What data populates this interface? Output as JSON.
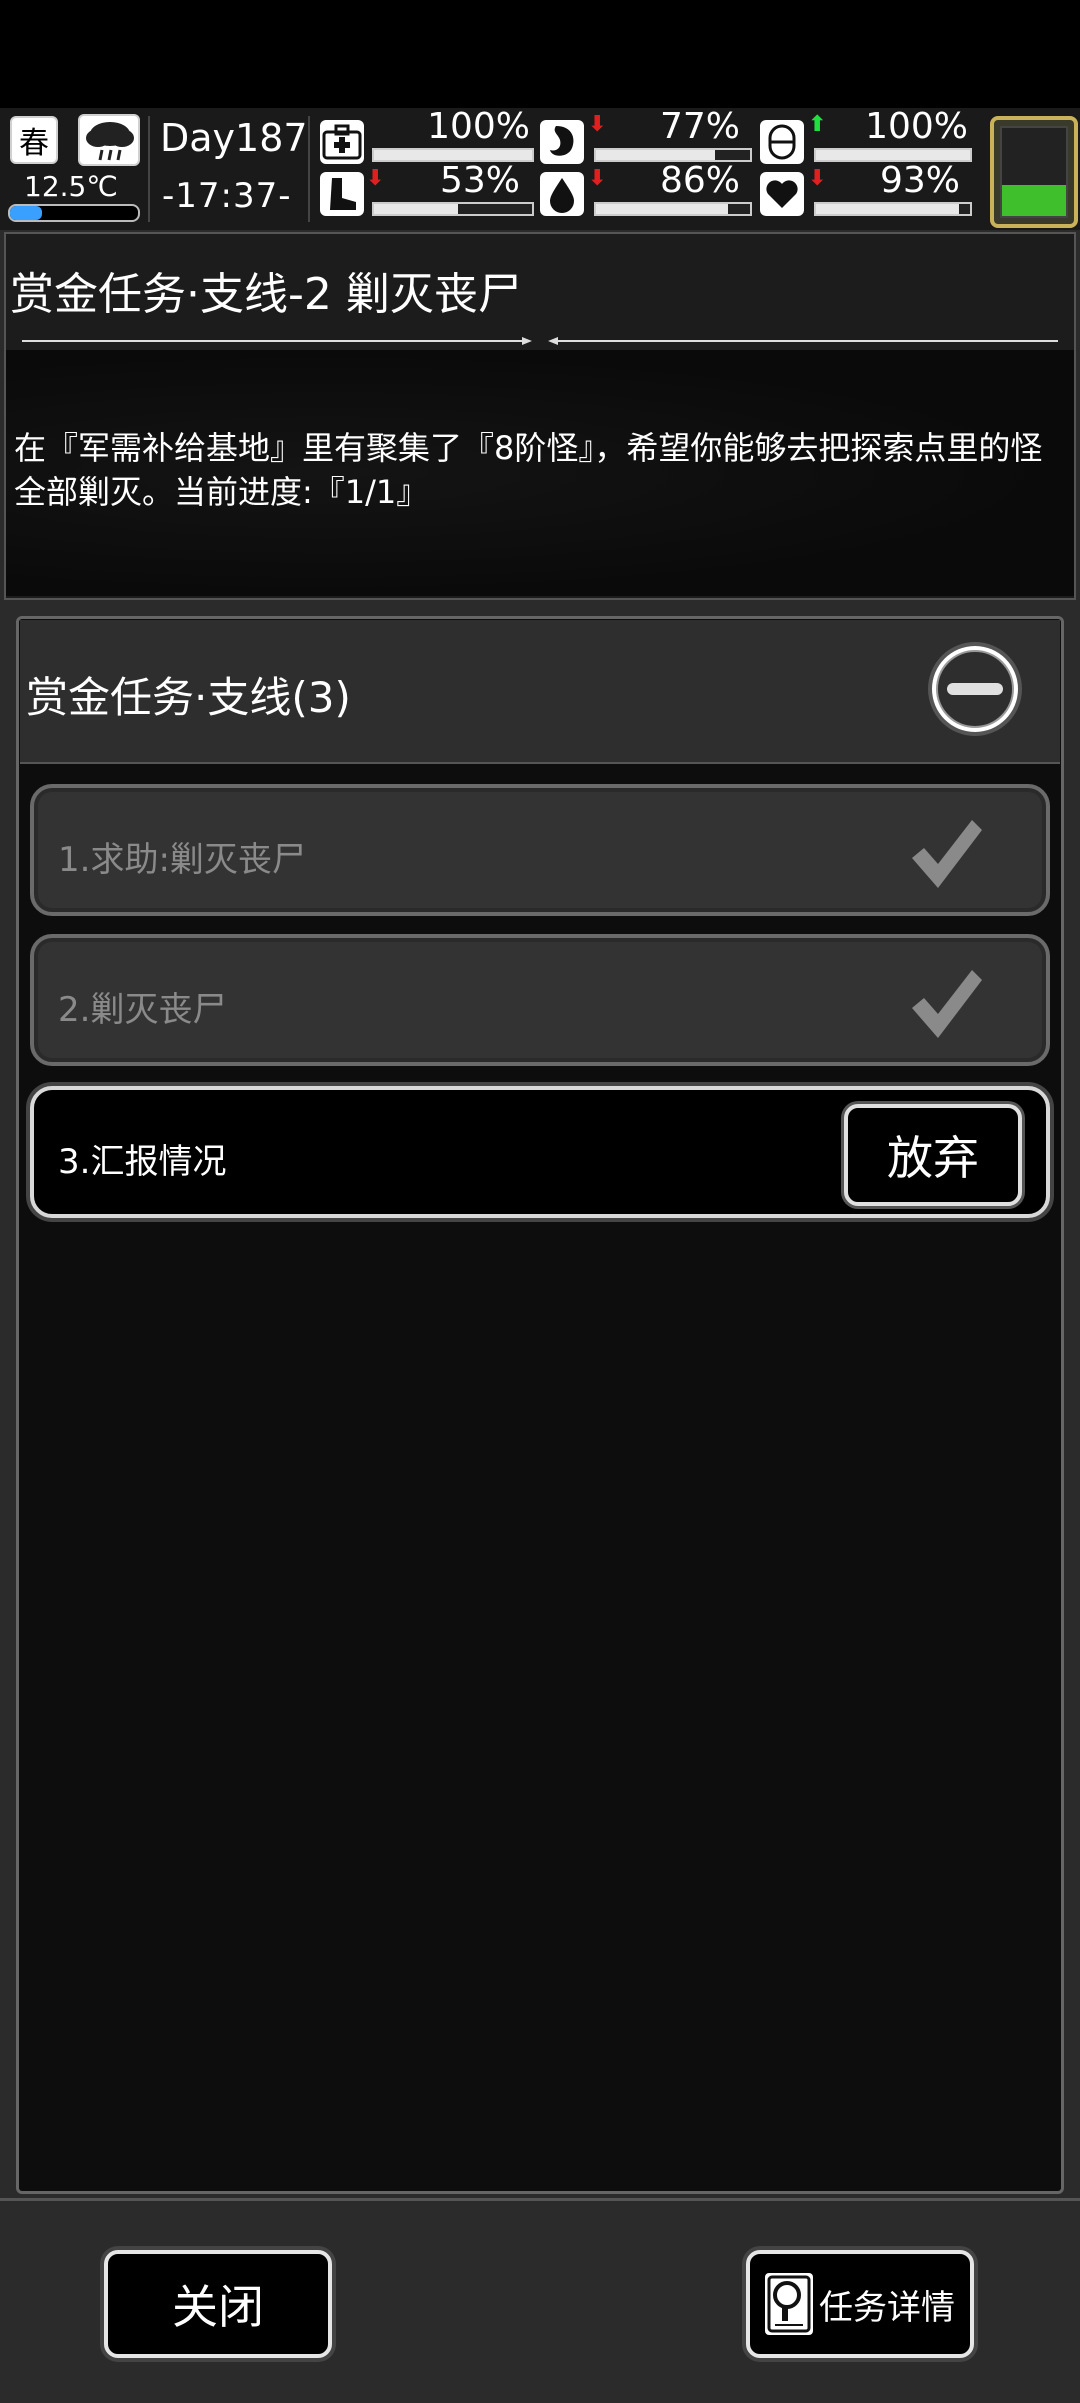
{
  "status": {
    "season": "春",
    "temperature": "12.5℃",
    "temperature_level": 0.25,
    "day": "Day187",
    "time": "-17:37-",
    "stats": [
      {
        "name": "health-icon",
        "value": "100%",
        "level": 1.0,
        "trend": "none"
      },
      {
        "name": "stomach-icon",
        "value": "77%",
        "level": 0.77,
        "trend": "down"
      },
      {
        "name": "mind-icon",
        "value": "100%",
        "level": 1.0,
        "trend": "up"
      },
      {
        "name": "boot-icon",
        "value": "53%",
        "level": 0.53,
        "trend": "down"
      },
      {
        "name": "water-icon",
        "value": "86%",
        "level": 0.86,
        "trend": "down"
      },
      {
        "name": "heart-icon",
        "value": "93%",
        "level": 0.93,
        "trend": "down"
      }
    ],
    "battery_level": 0.35,
    "battery_color": "#3fbf2c"
  },
  "quest": {
    "title": "赏金任务·支线-2 剿灭丧尸",
    "description": "在『军需补给基地』里有聚集了『8阶怪』，希望你能够去把探索点里的怪全部剿灭。当前进度:『1/1』"
  },
  "category": {
    "title": "赏金任务·支线(3)"
  },
  "tasks": [
    {
      "label": "1.求助:剿灭丧尸",
      "state": "done"
    },
    {
      "label": "2.剿灭丧尸",
      "state": "done"
    },
    {
      "label": "3.汇报情况",
      "state": "active",
      "action": "放弃"
    }
  ],
  "footer": {
    "close_label": "关闭",
    "detail_label": "任务详情"
  }
}
